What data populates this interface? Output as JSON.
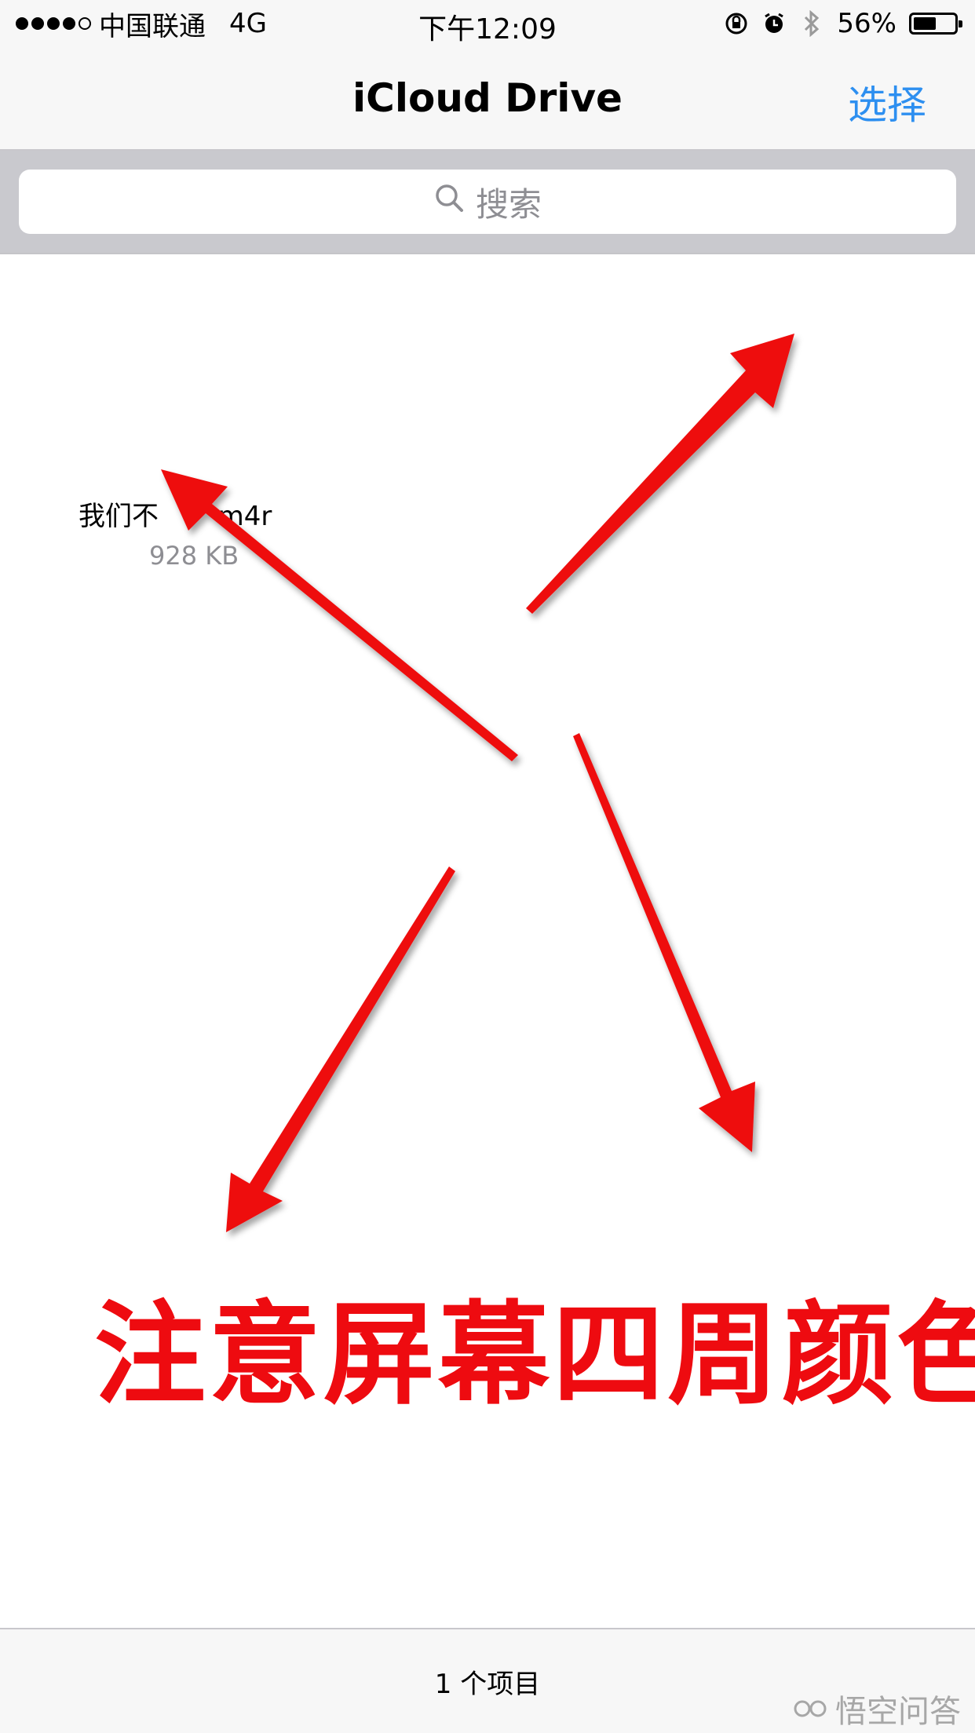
{
  "status_bar": {
    "carrier": "中国联通",
    "network": "4G",
    "time": "下午12:09",
    "battery_text": "56%",
    "battery_level": 0.56
  },
  "nav": {
    "title": "iCloud Drive",
    "select_label": "选择"
  },
  "search": {
    "placeholder": "搜索"
  },
  "file": {
    "name": "我们不       m4r",
    "size": "928 KB"
  },
  "annotation": {
    "text": "注意屏幕四周颜色",
    "color": "#ee0b10"
  },
  "toolbar": {
    "item_count": "1 个项目"
  },
  "watermark": {
    "text": "悟空问答"
  },
  "colors": {
    "accent": "#2d8ff0",
    "bar_bg": "#f7f7f7",
    "search_bg": "#c9c9ce"
  }
}
